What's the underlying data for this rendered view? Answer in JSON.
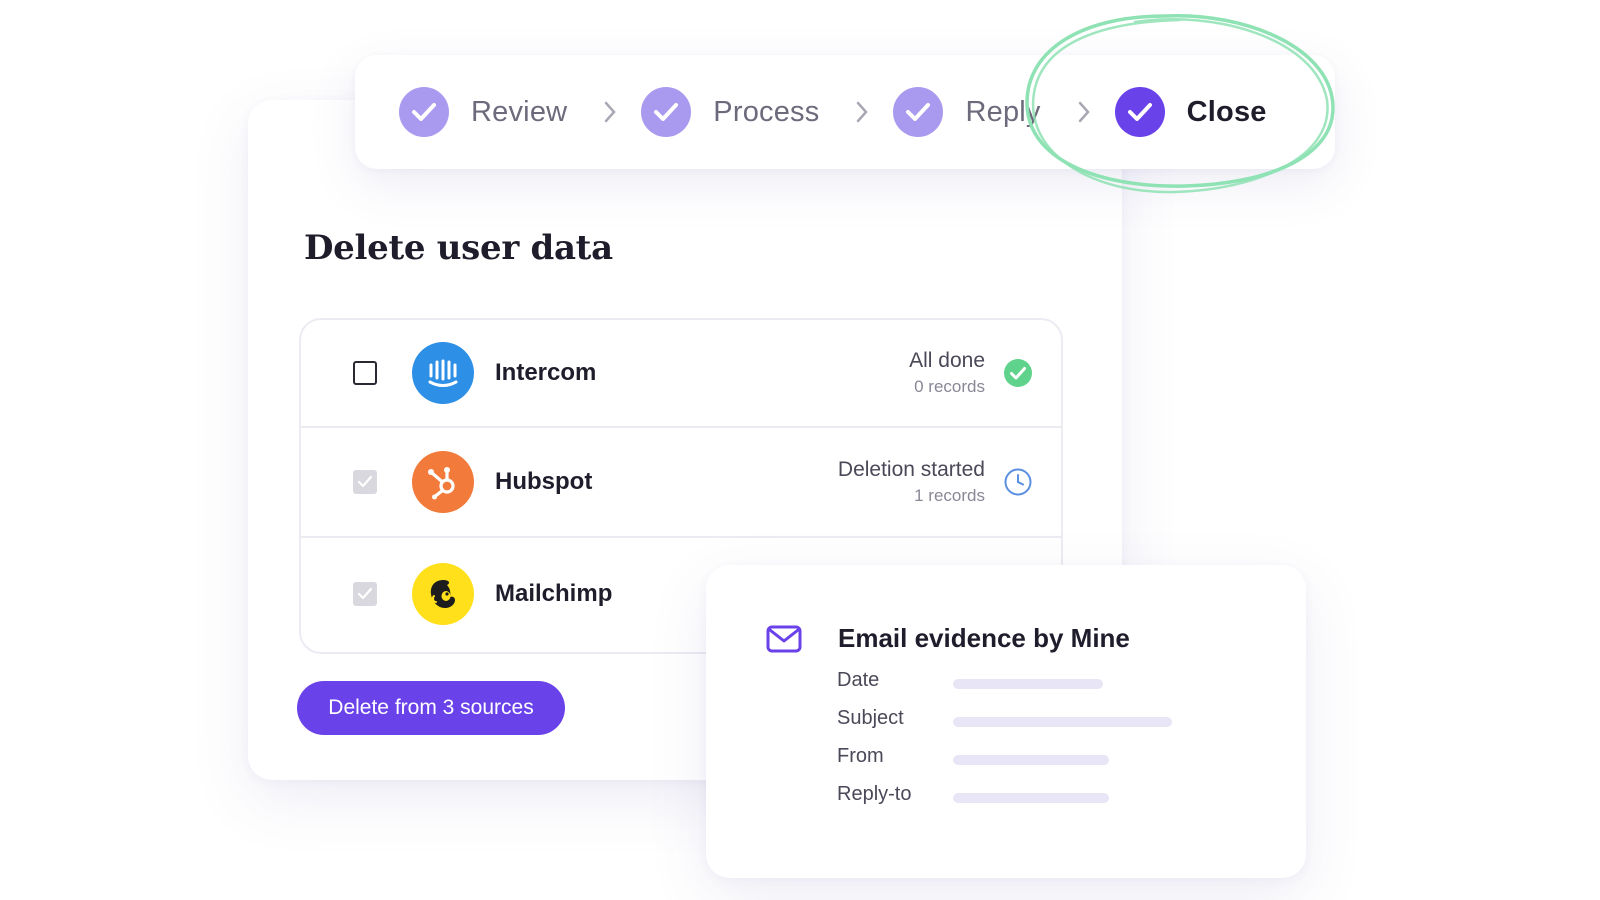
{
  "steps": [
    {
      "label": "Review",
      "state": "done"
    },
    {
      "label": "Process",
      "state": "done"
    },
    {
      "label": "Reply",
      "state": "done"
    },
    {
      "label": "Close",
      "state": "active"
    }
  ],
  "page_title": "Delete user data",
  "sources": [
    {
      "name": "Intercom",
      "checked": false,
      "status": "All done",
      "records": "0 records",
      "status_icon": "check-circle-icon",
      "logo_color": "#2e8fe6"
    },
    {
      "name": "Hubspot",
      "checked": true,
      "status": "Deletion started",
      "records": "1 records",
      "status_icon": "clock-icon",
      "logo_color": "#f27a3a"
    },
    {
      "name": "Mailchimp",
      "checked": true,
      "status": "",
      "records": "",
      "status_icon": "",
      "logo_color": "#ffe01b"
    }
  ],
  "delete_button_label": "Delete from 3 sources",
  "evidence": {
    "title": "Email evidence by Mine",
    "fields": [
      {
        "label": "Date",
        "fill": 0.5
      },
      {
        "label": "Subject",
        "fill": 0.73
      },
      {
        "label": "From",
        "fill": 0.52
      },
      {
        "label": "Reply-to",
        "fill": 0.52
      }
    ]
  },
  "colors": {
    "accent": "#6a42ea",
    "step_done": "#a99af0",
    "success": "#5fd38b",
    "pending": "#5b8fe0",
    "highlight_scribble": "#8ee2b4"
  }
}
